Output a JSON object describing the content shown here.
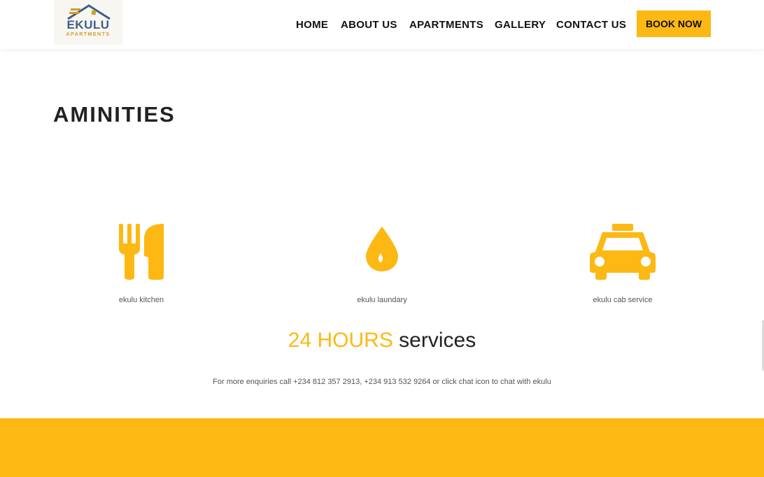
{
  "brand": {
    "name": "EKULU",
    "tagline": "APARTMENTS"
  },
  "nav": {
    "home": "HOME",
    "about": "ABOUT US",
    "apartments": "APARTMENTS",
    "gallery": "GALLERY",
    "contact": "CONTACT US",
    "book": "BOOK NOW"
  },
  "section": {
    "title": "AMINITIES"
  },
  "amenities": [
    {
      "label": "ekulu kitchen",
      "icon": "fork-knife-icon"
    },
    {
      "label": "ekulu laundary",
      "icon": "water-drop-icon"
    },
    {
      "label": "ekulu cab service",
      "icon": "taxi-icon"
    }
  ],
  "services": {
    "highlight": "24 HOURS",
    "rest": "services"
  },
  "enquiry": "For more enquiries call +234 812 357 2913, +234 913 532 9264 or click chat icon to chat with ekulu",
  "colors": {
    "accent": "#fdb813",
    "brand_blue": "#3d5f86",
    "text": "#222222"
  }
}
